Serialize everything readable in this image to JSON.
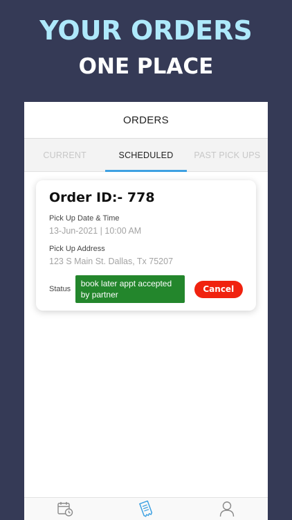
{
  "hero": {
    "line1": "YOUR ORDERS",
    "line2": "ONE PLACE"
  },
  "header": {
    "title": "ORDERS"
  },
  "tabs": [
    {
      "label": "CURRENT",
      "active": false
    },
    {
      "label": "SCHEDULED",
      "active": true
    },
    {
      "label": "PAST PICK UPS",
      "active": false
    }
  ],
  "order": {
    "id_text": "Order ID:- 778",
    "pickup_date_label": "Pick Up Date & Time",
    "pickup_date_value": "13-Jun-2021 | 10:00 AM",
    "pickup_address_label": "Pick Up Address",
    "pickup_address_value": "123 S Main St. Dallas, Tx 75207",
    "status_label": "Status",
    "status_value": "book later appt accepted by partner",
    "cancel_label": "Cancel"
  },
  "bottom_nav": [
    {
      "icon": "calendar-clock-icon"
    },
    {
      "icon": "receipt-icon"
    },
    {
      "icon": "user-icon"
    }
  ],
  "colors": {
    "background": "#353a56",
    "hero_accent": "#aee9fb",
    "tab_indicator": "#3ea1e2",
    "status_green": "#23862c",
    "cancel_red": "#f0220f"
  }
}
